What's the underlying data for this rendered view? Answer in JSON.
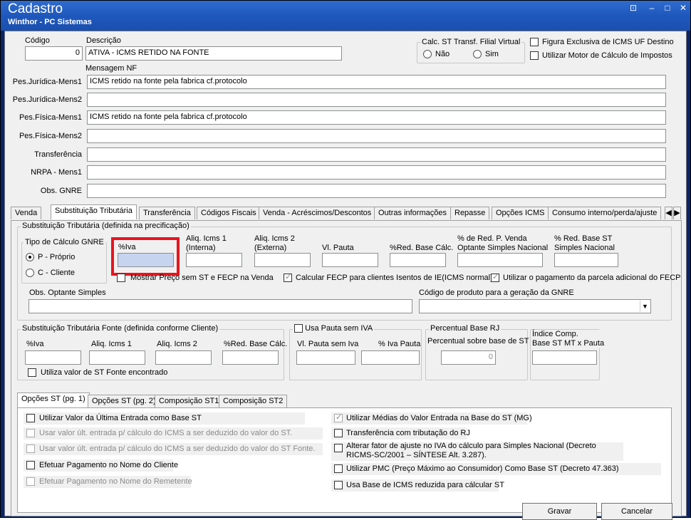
{
  "window": {
    "title": "Cadastro",
    "subtitle": "Winthor - PC Sistemas",
    "controls": [
      "⊡",
      "–",
      "□",
      "✕"
    ]
  },
  "header": {
    "codigo_label": "Código",
    "codigo_value": "0",
    "descricao_label": "Descrição",
    "descricao_value": "ATIVA - ICMS RETIDO NA FONTE",
    "calc_st_group": "Calc. ST Transf. Filial Virtual",
    "calc_st_nao": "Não",
    "calc_st_sim": "Sim",
    "figura_exclusiva": "Figura Exclusiva de ICMS UF Destino",
    "utilizar_motor": "Utilizar Motor de Cálculo de Impostos",
    "mensagem_nf": "Mensagem NF"
  },
  "mensagens": [
    {
      "label": "Pes.Jurídica-Mens1",
      "value": "ICMS retido na fonte pela fabrica  cf.protocolo"
    },
    {
      "label": "Pes.Jurídica-Mens2",
      "value": ""
    },
    {
      "label": "Pes.Física-Mens1",
      "value": "ICMS retido na fonte pela fabrica  cf.protocolo"
    },
    {
      "label": "Pes.Física-Mens2",
      "value": ""
    },
    {
      "label": "Transferência",
      "value": ""
    },
    {
      "label": "NRPA - Mens1",
      "value": ""
    },
    {
      "label": "Obs. GNRE",
      "value": ""
    }
  ],
  "tabs": [
    "Venda",
    "Substituição Tributária",
    "Transferência",
    "Códigos Fiscais",
    "Venda - Acréscimos/Descontos",
    "Outras informações",
    "Repasse",
    "Opções ICMS",
    "Consumo interno/perda/ajuste"
  ],
  "st": {
    "group_title": "Substituição Tributária (definida na precificação)",
    "tipo_calc_title": "Tipo de Cálculo GNRE",
    "tipo_p": "P - Próprio",
    "tipo_c": "C - Cliente",
    "iva_label": "%Iva",
    "aliq_interna": "Aliq. Icms 1\n(Interna)",
    "aliq_interna_l1": "Aliq. Icms 1",
    "aliq_interna_l2": "(Interna)",
    "aliq_externa_l1": "Aliq. Icms 2",
    "aliq_externa_l2": "(Externa)",
    "vl_pauta": "Vl. Pauta",
    "red_base": "%Red. Base Cálc.",
    "red_p_venda_l1": "% de Red. P. Venda",
    "red_p_venda_l2": "Optante Simples Nacional",
    "red_base_st_l1": "% Red. Base ST",
    "red_base_st_l2": "Simples Nacional",
    "mostrar_preco": "Mostrar Preço sem ST e FECP na Venda",
    "calcular_fecp": "Calcular FECP para clientes Isentos de IE(ICMS normal)",
    "utilizar_pagamento": "Utilizar o pagamento da parcela adicional do FECP",
    "obs_optante": "Obs. Optante Simples",
    "codigo_gnre": "Código de produto para a geração da GNRE"
  },
  "st_fonte": {
    "group_title": "Substituição Tributária Fonte (definida conforme Cliente)",
    "iva": "%Iva",
    "aliq1": "Aliq. Icms 1",
    "aliq2": "Aliq. Icms 2",
    "red_base": "%Red. Base Cálc.",
    "utiliza_valor": "Utiliza valor de ST Fonte encontrado",
    "usa_pauta": "Usa Pauta sem IVA",
    "vl_pauta_sem_iva": "Vl. Pauta sem Iva",
    "iva_pauta": "% Iva Pauta",
    "percentual_base_rj": "Percentual Base RJ",
    "percentual_sobre": "Percentual sobre base de ST",
    "percentual_value": "0",
    "indice_l1": "Índice Comp.",
    "indice_l2": "Base ST MT x Pauta"
  },
  "subtabs": [
    "Opções ST (pg. 1)",
    "Opções ST (pg. 2)",
    "Composição ST1",
    "Composição ST2"
  ],
  "options_left": [
    {
      "label": "Utilizar Valor da Última Entrada como Base ST",
      "disabled": false
    },
    {
      "label": "Usar valor últ. entrada p/ cálculo do ICMS a ser deduzido do valor do ST.",
      "disabled": true
    },
    {
      "label": "Usar valor últ. entrada p/ cálculo do ICMS a ser deduzido do valor do ST Fonte.",
      "disabled": true
    },
    {
      "label": "Efetuar Pagamento no Nome do Cliente",
      "disabled": false
    },
    {
      "label": "Efetuar Pagamento no Nome do Remetente",
      "disabled": true
    }
  ],
  "options_right": {
    "medias": "Utilizar Médias do Valor Entrada na Base do ST (MG)",
    "transferencia_rj": "Transferência com tributação do RJ",
    "alterar_l1": "Alterar fator de ajuste no IVA do cálculo para Simples Nacional (Decreto",
    "alterar_l2": "RICMS-SC/2001 – SÍNTESE Alt. 3.287).",
    "pmc": "Utilizar PMC (Preço Máximo ao Consumidor) Como Base ST (Decreto 47.363)",
    "base_reduzida": "Usa Base de ICMS reduzida para cálcular ST"
  },
  "buttons": {
    "gravar": "Gravar",
    "cancelar": "Cancelar"
  },
  "colors": {
    "title_bar": "#1f58bd",
    "highlight": "#e8141e",
    "iva_field": "#c6d4f0"
  }
}
